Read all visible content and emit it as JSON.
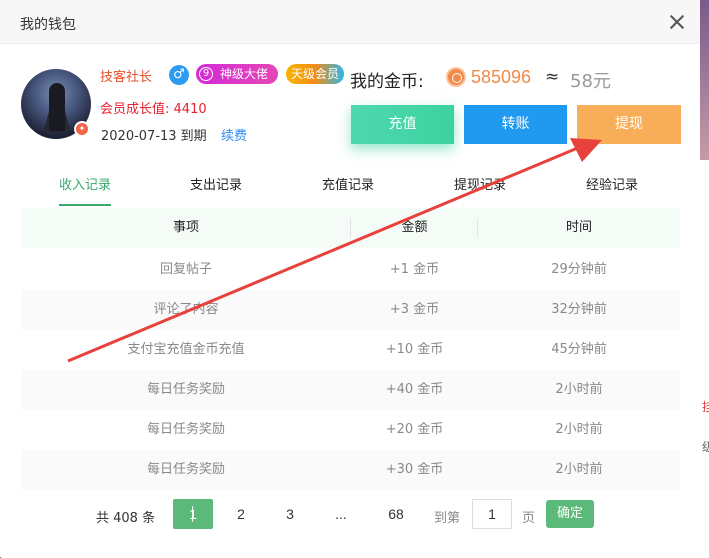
{
  "dialog": {
    "title": "我的钱包",
    "close_label": ""
  },
  "profile": {
    "username": "技客社长",
    "gender_icon": "male-icon",
    "gender_symbol": "♂",
    "level_number": "9",
    "level_label": "神级大佬",
    "vip_label": "天级会员",
    "growth_label": "会员成长值:",
    "growth_value": "4410",
    "expire_text": "2020-07-13 到期",
    "renew_label": "续费",
    "avatar_badge": "✦"
  },
  "wallet": {
    "coins_label": "我的金币:",
    "coin_icon": "coin-icon",
    "coins_value": "585096",
    "approx": "≈",
    "rmb_value": "58元",
    "buttons": {
      "recharge": "充值",
      "transfer": "转账",
      "withdraw": "提现"
    }
  },
  "tabs": [
    {
      "label": "收入记录",
      "active": true
    },
    {
      "label": "支出记录"
    },
    {
      "label": "充值记录"
    },
    {
      "label": "提现记录"
    },
    {
      "label": "经验记录"
    }
  ],
  "table": {
    "headers": [
      "事项",
      "金额",
      "时间"
    ],
    "rows": [
      {
        "item": "回复帖子",
        "amount": "+1 金币",
        "time": "29分钟前"
      },
      {
        "item": "评论了内容",
        "amount": "+3 金币",
        "time": "32分钟前"
      },
      {
        "item": "支付宝充值金币充值",
        "amount": "+10 金币",
        "time": "45分钟前"
      },
      {
        "item": "每日任务奖励",
        "amount": "+40 金币",
        "time": "2小时前"
      },
      {
        "item": "每日任务奖励",
        "amount": "+20 金币",
        "time": "2小时前"
      },
      {
        "item": "每日任务奖励",
        "amount": "+30 金币",
        "time": "2小时前"
      }
    ]
  },
  "pagination": {
    "total": "共 408 条",
    "pages": [
      "1",
      "2",
      "3",
      "...",
      "68"
    ],
    "goto_prefix": "到第",
    "goto_value": "1",
    "goto_suffix": "页",
    "confirm": "确定"
  },
  "background": {
    "right_text_1": "挂",
    "right_text_2": "级"
  },
  "colors": {
    "accent_green": "#3aa96e",
    "coin_orange": "#f08a4b",
    "recharge_green": "#3cd29e",
    "transfer_blue": "#1f9af0",
    "withdraw_orange": "#f8ae58",
    "annotation_red": "#e8403a"
  }
}
